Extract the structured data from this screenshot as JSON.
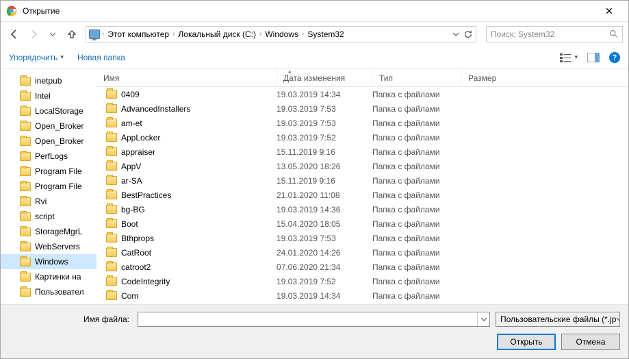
{
  "window": {
    "title": "Открытие"
  },
  "nav": {
    "crumbs": [
      "Этот компьютер",
      "Локальный диск (C:)",
      "Windows",
      "System32"
    ],
    "search_placeholder": "Поиск: System32"
  },
  "toolbar": {
    "organize": "Упорядочить",
    "newfolder": "Новая папка"
  },
  "columns": {
    "name": "Имя",
    "date": "Дата изменения",
    "type": "Тип",
    "size": "Размер"
  },
  "tree": [
    {
      "label": "inetpub"
    },
    {
      "label": "Intel"
    },
    {
      "label": "LocalStorage"
    },
    {
      "label": "Open_Broker"
    },
    {
      "label": "Open_Broker"
    },
    {
      "label": "PerfLogs"
    },
    {
      "label": "Program File"
    },
    {
      "label": "Program File"
    },
    {
      "label": "Rvi"
    },
    {
      "label": "script"
    },
    {
      "label": "StorageMgrL"
    },
    {
      "label": "WebServers"
    },
    {
      "label": "Windows",
      "selected": true
    },
    {
      "label": "Картинки на"
    },
    {
      "label": "Пользовател"
    }
  ],
  "files": [
    {
      "name": "0409",
      "date": "19.03.2019 14:34",
      "type": "Папка с файлами"
    },
    {
      "name": "AdvancedInstallers",
      "date": "19.03.2019 7:53",
      "type": "Папка с файлами"
    },
    {
      "name": "am-et",
      "date": "19.03.2019 7:53",
      "type": "Папка с файлами"
    },
    {
      "name": "AppLocker",
      "date": "19.03.2019 7:52",
      "type": "Папка с файлами"
    },
    {
      "name": "appraiser",
      "date": "15.11.2019 9:16",
      "type": "Папка с файлами"
    },
    {
      "name": "AppV",
      "date": "13.05.2020 18:26",
      "type": "Папка с файлами"
    },
    {
      "name": "ar-SA",
      "date": "15.11.2019 9:16",
      "type": "Папка с файлами"
    },
    {
      "name": "BestPractices",
      "date": "21.01.2020 11:08",
      "type": "Папка с файлами"
    },
    {
      "name": "bg-BG",
      "date": "19.03.2019 14:36",
      "type": "Папка с файлами"
    },
    {
      "name": "Boot",
      "date": "15.04.2020 18:05",
      "type": "Папка с файлами"
    },
    {
      "name": "Bthprops",
      "date": "19.03.2019 7:53",
      "type": "Папка с файлами"
    },
    {
      "name": "CatRoot",
      "date": "24.01.2020 14:26",
      "type": "Папка с файлами"
    },
    {
      "name": "catroot2",
      "date": "07.06.2020 21:34",
      "type": "Папка с файлами"
    },
    {
      "name": "CodeIntegrity",
      "date": "19.03.2019 7:52",
      "type": "Папка с файлами"
    },
    {
      "name": "Com",
      "date": "19.03.2019 14:34",
      "type": "Папка с файлами"
    }
  ],
  "footer": {
    "filename_label": "Имя файла:",
    "filter": "Пользовательские файлы (*.jp",
    "open": "Открыть",
    "cancel": "Отмена"
  }
}
